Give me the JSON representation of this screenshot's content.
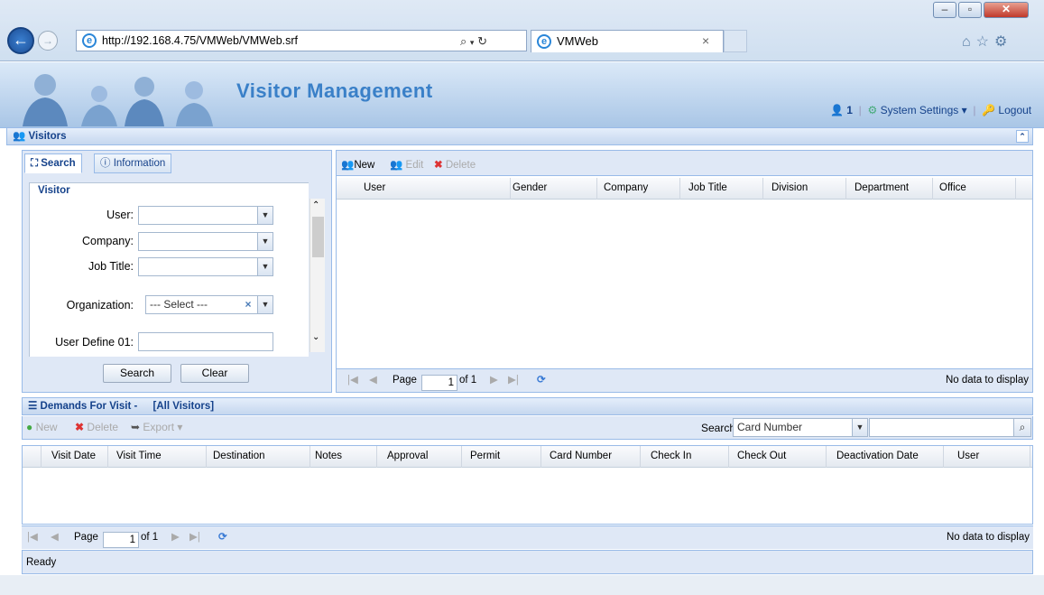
{
  "browser": {
    "url": "http://192.168.4.75/VMWeb/VMWeb.srf",
    "tab_title": "VMWeb",
    "tab_close": "×"
  },
  "app": {
    "title": "Visitor Management",
    "user_count": "1",
    "system_settings": "System Settings",
    "logout": "Logout"
  },
  "visitors_panel": {
    "title": "Visitors",
    "tabs": [
      "Search",
      "Information"
    ],
    "legend": "Visitor",
    "fields": {
      "user": "User:",
      "company": "Company:",
      "job_title": "Job Title:",
      "organization": "Organization:",
      "organization_value": "--- Select ---",
      "user_define_01": "User Define 01:"
    },
    "search_btn": "Search",
    "clear_btn": "Clear"
  },
  "visitor_grid": {
    "toolbar": {
      "new": "New",
      "edit": "Edit",
      "delete": "Delete"
    },
    "columns": [
      "User",
      "Gender",
      "Company",
      "Job Title",
      "Division",
      "Department",
      "Office"
    ],
    "pager": {
      "page_label": "Page",
      "page": "1",
      "of": "of 1",
      "status": "No data to display"
    }
  },
  "demands": {
    "title": "Demands For Visit -",
    "filter": "[All Visitors]",
    "toolbar": {
      "new": "New",
      "delete": "Delete",
      "export": "Export"
    },
    "search_label": "Search:",
    "search_field": "Card Number",
    "columns": [
      "Visit Date",
      "Visit Time",
      "Destination",
      "Notes",
      "Approval",
      "Permit",
      "Card Number",
      "Check In",
      "Check Out",
      "Deactivation Date",
      "User"
    ],
    "pager": {
      "page_label": "Page",
      "page": "1",
      "of": "of 1",
      "status": "No data to display"
    }
  },
  "status_bar": "Ready"
}
